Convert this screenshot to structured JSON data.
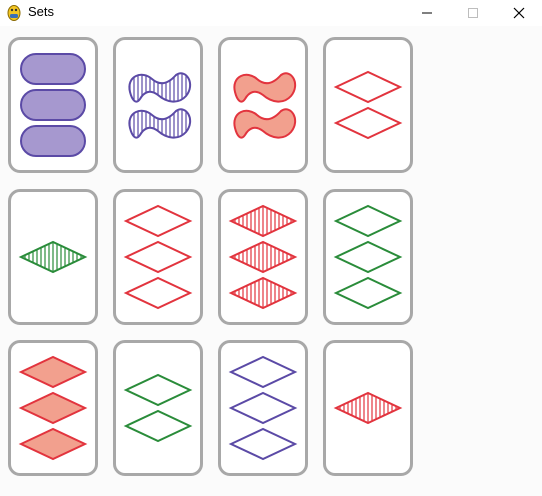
{
  "window": {
    "title": "Sets",
    "icon": "python-icon",
    "controls": [
      "minimize-icon",
      "maximize-icon",
      "close-icon"
    ]
  },
  "colors": {
    "red": "#e2343e",
    "green": "#2a8c3a",
    "purple": "#5b4aa6",
    "card_border": "#a8a8a8"
  },
  "cards": [
    {
      "count": 3,
      "shape": "oval",
      "color": "purple",
      "fill": "solid"
    },
    {
      "count": 2,
      "shape": "squiggle",
      "color": "purple",
      "fill": "striped"
    },
    {
      "count": 2,
      "shape": "squiggle",
      "color": "red",
      "fill": "solid"
    },
    {
      "count": 2,
      "shape": "diamond",
      "color": "red",
      "fill": "empty"
    },
    {
      "count": 1,
      "shape": "diamond",
      "color": "green",
      "fill": "striped"
    },
    {
      "count": 3,
      "shape": "diamond",
      "color": "red",
      "fill": "empty"
    },
    {
      "count": 3,
      "shape": "diamond",
      "color": "red",
      "fill": "striped"
    },
    {
      "count": 3,
      "shape": "diamond",
      "color": "green",
      "fill": "empty"
    },
    {
      "count": 3,
      "shape": "diamond",
      "color": "red",
      "fill": "solid"
    },
    {
      "count": 2,
      "shape": "diamond",
      "color": "green",
      "fill": "empty"
    },
    {
      "count": 3,
      "shape": "diamond",
      "color": "purple",
      "fill": "empty"
    },
    {
      "count": 1,
      "shape": "diamond",
      "color": "red",
      "fill": "striped"
    }
  ]
}
